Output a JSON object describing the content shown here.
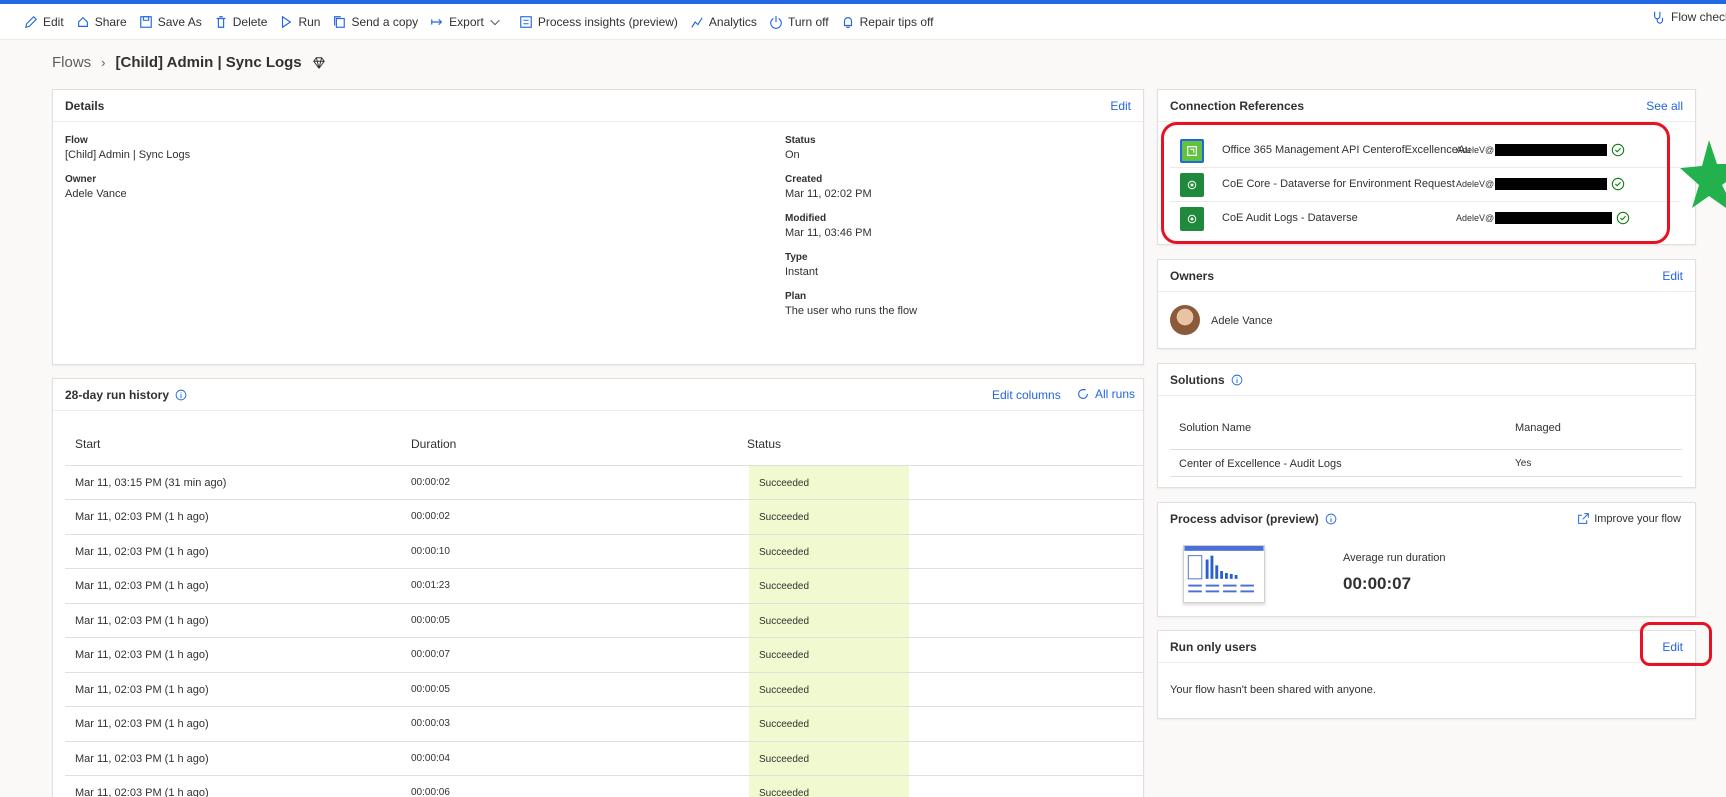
{
  "command_bar": {
    "items": [
      {
        "label": "Edit",
        "icon": "pencil-icon"
      },
      {
        "label": "Share",
        "icon": "share-icon"
      },
      {
        "label": "Save As",
        "icon": "save-as-icon"
      },
      {
        "label": "Delete",
        "icon": "trash-icon"
      },
      {
        "label": "Run",
        "icon": "play-icon"
      },
      {
        "label": "Send a copy",
        "icon": "copy-icon"
      },
      {
        "label": "Export",
        "icon": "export-icon"
      },
      {
        "label": "Process insights (preview)",
        "icon": "process-icon"
      },
      {
        "label": "Analytics",
        "icon": "chart-icon"
      },
      {
        "label": "Turn off",
        "icon": "power-icon"
      },
      {
        "label": "Repair tips off",
        "icon": "bell-icon"
      }
    ],
    "right_label": "Flow checker"
  },
  "breadcrumb": {
    "root": "Flows",
    "current": "[Child] Admin | Sync Logs"
  },
  "details": {
    "title": "Details",
    "edit": "Edit",
    "flow_label": "Flow",
    "flow_value": "[Child] Admin | Sync Logs",
    "owner_label": "Owner",
    "owner_value": "Adele Vance",
    "status_label": "Status",
    "status_value": "On",
    "created_label": "Created",
    "created_value": "Mar 11, 02:02 PM",
    "modified_label": "Modified",
    "modified_value": "Mar 11, 03:46 PM",
    "type_label": "Type",
    "type_value": "Instant",
    "plan_label": "Plan",
    "plan_value": "The user who runs the flow"
  },
  "run_history": {
    "title": "28-day run history",
    "edit_columns": "Edit columns",
    "all_runs": "All runs",
    "columns": [
      "Start",
      "Duration",
      "Status"
    ],
    "rows": [
      {
        "start": "Mar 11, 03:15 PM (31 min ago)",
        "duration": "00:00:02",
        "status": "Succeeded"
      },
      {
        "start": "Mar 11, 02:03 PM (1 h ago)",
        "duration": "00:00:02",
        "status": "Succeeded"
      },
      {
        "start": "Mar 11, 02:03 PM (1 h ago)",
        "duration": "00:00:10",
        "status": "Succeeded"
      },
      {
        "start": "Mar 11, 02:03 PM (1 h ago)",
        "duration": "00:01:23",
        "status": "Succeeded"
      },
      {
        "start": "Mar 11, 02:03 PM (1 h ago)",
        "duration": "00:00:05",
        "status": "Succeeded"
      },
      {
        "start": "Mar 11, 02:03 PM (1 h ago)",
        "duration": "00:00:07",
        "status": "Succeeded"
      },
      {
        "start": "Mar 11, 02:03 PM (1 h ago)",
        "duration": "00:00:05",
        "status": "Succeeded"
      },
      {
        "start": "Mar 11, 02:03 PM (1 h ago)",
        "duration": "00:00:03",
        "status": "Succeeded"
      },
      {
        "start": "Mar 11, 02:03 PM (1 h ago)",
        "duration": "00:00:04",
        "status": "Succeeded"
      },
      {
        "start": "Mar 11, 02:03 PM (1 h ago)",
        "duration": "00:00:06",
        "status": "Succeeded"
      }
    ]
  },
  "connections": {
    "title": "Connection References",
    "see_all": "See all",
    "items": [
      {
        "name": "Office 365 Management API CenterofExcellenceAu",
        "account": "AdeleV@",
        "icon": "office365-api-icon",
        "color": "#5fc33e"
      },
      {
        "name": "CoE Core - Dataverse for Environment Request",
        "account": "AdeleV@",
        "icon": "dataverse-icon",
        "color": "#1f8a3b"
      },
      {
        "name": "CoE Audit Logs - Dataverse",
        "account": "AdeleV@",
        "icon": "dataverse-icon",
        "color": "#1f8a3b"
      }
    ]
  },
  "owners": {
    "title": "Owners",
    "edit": "Edit",
    "name": "Adele Vance"
  },
  "solutions": {
    "title": "Solutions",
    "columns": [
      "Solution Name",
      "Managed"
    ],
    "rows": [
      {
        "name": "Center of Excellence - Audit Logs",
        "managed": "Yes"
      }
    ]
  },
  "process_advisor": {
    "title": "Process advisor (preview)",
    "improve": "Improve your flow",
    "avg_label": "Average run duration",
    "avg_value": "00:00:07"
  },
  "run_only": {
    "title": "Run only users",
    "edit": "Edit",
    "message": "Your flow hasn't been shared with anyone."
  },
  "colors": {
    "accent": "#2266e3",
    "success_bg": "#f1f9d0",
    "highlight": "#e81123",
    "star": "#22b14c"
  }
}
